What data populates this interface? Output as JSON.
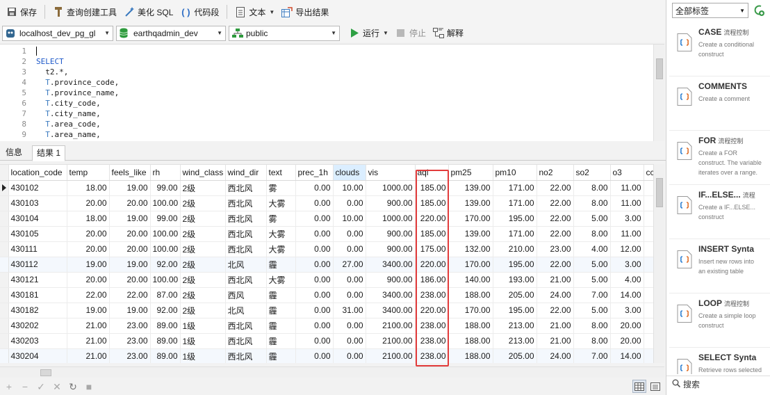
{
  "toolbar": {
    "save": "保存",
    "query_builder": "查询创建工具",
    "beautify": "美化 SQL",
    "snippet": "代码段",
    "text": "文本",
    "export": "导出结果"
  },
  "connection_bar": {
    "connection": "localhost_dev_pg_gl",
    "database": "earthqadmin_dev",
    "schema": "public",
    "run": "运行",
    "stop": "停止",
    "explain": "解释"
  },
  "editor": {
    "line_numbers": [
      "1",
      "2",
      "3",
      "4",
      "5",
      "6",
      "7",
      "8",
      "9"
    ],
    "lines": [
      {
        "indent": "",
        "alias": "",
        "text": ""
      },
      {
        "indent": "",
        "alias": "",
        "text": "SELECT",
        "kw": true
      },
      {
        "indent": "  ",
        "alias": "",
        "text": "t2.*,"
      },
      {
        "indent": "  ",
        "alias": "T",
        "text": ".province_code,"
      },
      {
        "indent": "  ",
        "alias": "T",
        "text": ".province_name,"
      },
      {
        "indent": "  ",
        "alias": "T",
        "text": ".city_code,"
      },
      {
        "indent": "  ",
        "alias": "T",
        "text": ".city_name,"
      },
      {
        "indent": "  ",
        "alias": "T",
        "text": ".area_code,"
      },
      {
        "indent": "  ",
        "alias": "T",
        "text": ".area_name,"
      }
    ]
  },
  "tabs": {
    "info": "信息",
    "result": "结果 1"
  },
  "grid": {
    "highlighted_column": "clouds",
    "columns": [
      "location_code",
      "temp",
      "feels_like",
      "rh",
      "wind_class",
      "wind_dir",
      "text",
      "prec_1h",
      "clouds",
      "vis",
      "aqi",
      "pm25",
      "pm10",
      "no2",
      "so2",
      "o3",
      "cc"
    ],
    "numeric_columns": [
      "temp",
      "feels_like",
      "rh",
      "prec_1h",
      "clouds",
      "vis",
      "aqi",
      "pm25",
      "pm10",
      "no2",
      "so2",
      "o3"
    ],
    "rows": [
      [
        "430102",
        "18.00",
        "19.00",
        "99.00",
        "2级",
        "西北风",
        "雾",
        "0.00",
        "10.00",
        "1000.00",
        "185.00",
        "139.00",
        "171.00",
        "22.00",
        "8.00",
        "11.00",
        ""
      ],
      [
        "430103",
        "20.00",
        "20.00",
        "100.00",
        "2级",
        "西北风",
        "大雾",
        "0.00",
        "0.00",
        "900.00",
        "185.00",
        "139.00",
        "171.00",
        "22.00",
        "8.00",
        "11.00",
        ""
      ],
      [
        "430104",
        "18.00",
        "19.00",
        "99.00",
        "2级",
        "西北风",
        "雾",
        "0.00",
        "10.00",
        "1000.00",
        "220.00",
        "170.00",
        "195.00",
        "22.00",
        "5.00",
        "3.00",
        ""
      ],
      [
        "430105",
        "20.00",
        "20.00",
        "100.00",
        "2级",
        "西北风",
        "大雾",
        "0.00",
        "0.00",
        "900.00",
        "185.00",
        "139.00",
        "171.00",
        "22.00",
        "8.00",
        "11.00",
        ""
      ],
      [
        "430111",
        "20.00",
        "20.00",
        "100.00",
        "2级",
        "西北风",
        "大雾",
        "0.00",
        "0.00",
        "900.00",
        "175.00",
        "132.00",
        "210.00",
        "23.00",
        "4.00",
        "12.00",
        ""
      ],
      [
        "430112",
        "19.00",
        "19.00",
        "92.00",
        "2级",
        "北风",
        "霾",
        "0.00",
        "27.00",
        "3400.00",
        "220.00",
        "170.00",
        "195.00",
        "22.00",
        "5.00",
        "3.00",
        ""
      ],
      [
        "430121",
        "20.00",
        "20.00",
        "100.00",
        "2级",
        "西北风",
        "大雾",
        "0.00",
        "0.00",
        "900.00",
        "186.00",
        "140.00",
        "193.00",
        "21.00",
        "5.00",
        "4.00",
        ""
      ],
      [
        "430181",
        "22.00",
        "22.00",
        "87.00",
        "2级",
        "西风",
        "霾",
        "0.00",
        "0.00",
        "3400.00",
        "238.00",
        "188.00",
        "205.00",
        "24.00",
        "7.00",
        "14.00",
        ""
      ],
      [
        "430182",
        "19.00",
        "19.00",
        "92.00",
        "2级",
        "北风",
        "霾",
        "0.00",
        "31.00",
        "3400.00",
        "220.00",
        "170.00",
        "195.00",
        "22.00",
        "5.00",
        "3.00",
        ""
      ],
      [
        "430202",
        "21.00",
        "23.00",
        "89.00",
        "1级",
        "西北风",
        "霾",
        "0.00",
        "0.00",
        "2100.00",
        "238.00",
        "188.00",
        "213.00",
        "21.00",
        "8.00",
        "20.00",
        ""
      ],
      [
        "430203",
        "21.00",
        "23.00",
        "89.00",
        "1级",
        "西北风",
        "霾",
        "0.00",
        "0.00",
        "2100.00",
        "238.00",
        "188.00",
        "213.00",
        "21.00",
        "8.00",
        "20.00",
        ""
      ],
      [
        "430204",
        "21.00",
        "23.00",
        "89.00",
        "1级",
        "西北风",
        "霾",
        "0.00",
        "0.00",
        "2100.00",
        "238.00",
        "188.00",
        "205.00",
        "24.00",
        "7.00",
        "14.00",
        ""
      ]
    ]
  },
  "right_panel": {
    "tag_filter": "全部标签",
    "search_placeholder": "搜索",
    "snippets": [
      {
        "title": "CASE",
        "tag": "流程控制",
        "desc": "Create a conditional construct"
      },
      {
        "title": "COMMENTS",
        "tag": "",
        "desc": "Create a comment"
      },
      {
        "title": "FOR",
        "tag": "流程控制",
        "desc": "Create a FOR construct. The variable iterates over a range."
      },
      {
        "title": "IF...ELSE...",
        "tag": "流程",
        "desc": "Create a IF...ELSE... construct"
      },
      {
        "title": "INSERT Synta",
        "tag": "",
        "desc": "Insert new rows into an existing table"
      },
      {
        "title": "LOOP",
        "tag": "流程控制",
        "desc": "Create a simple loop construct"
      },
      {
        "title": "SELECT Synta",
        "tag": "",
        "desc": "Retrieve rows selected from one or more tables"
      }
    ]
  },
  "colors": {
    "keyword": "#1d58c9",
    "highlight_header": "#dbeeff",
    "selection_box": "#e23b3b",
    "run_green": "#2ea043"
  }
}
